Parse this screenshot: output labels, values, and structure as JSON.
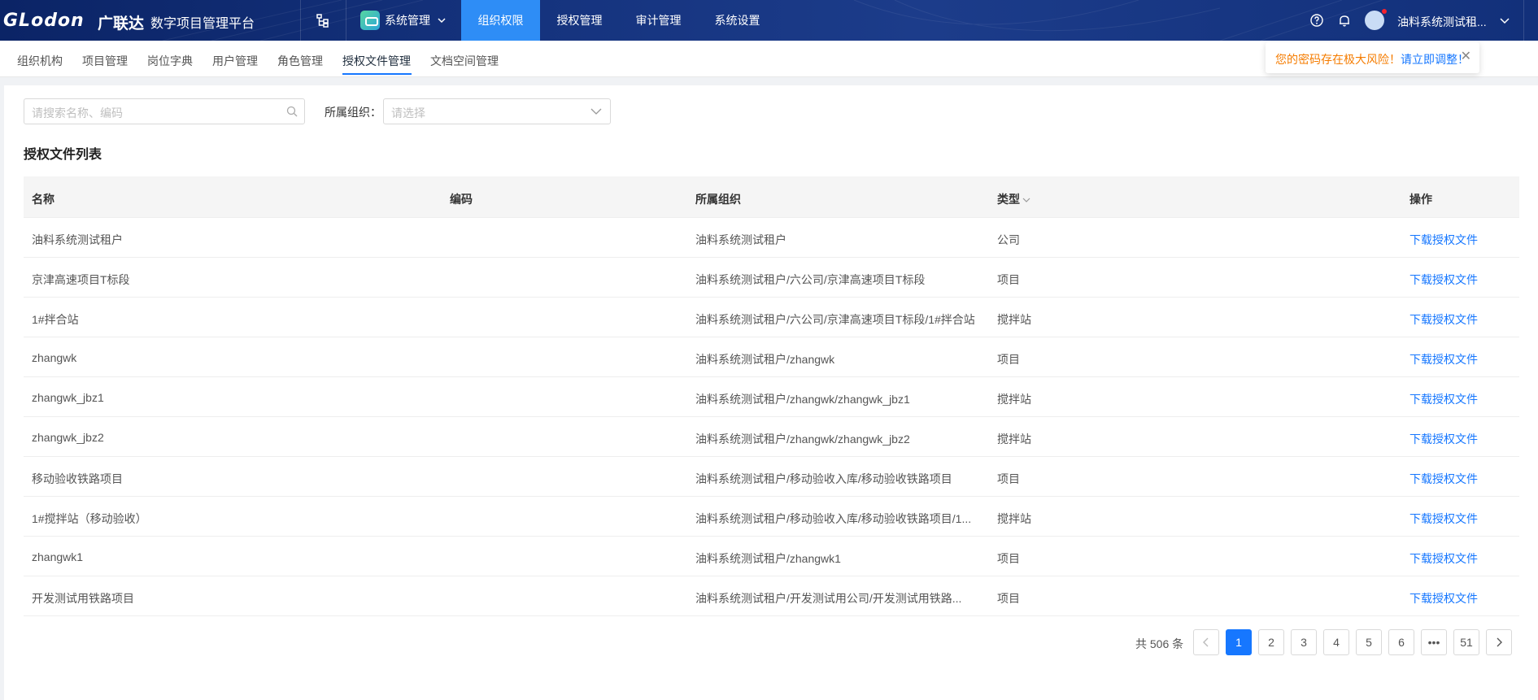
{
  "header": {
    "logo": "GLodon",
    "logo_cn": "广联达",
    "platform": "数字项目管理平台",
    "app_switcher": "系统管理",
    "nav": [
      "组织权限",
      "授权管理",
      "审计管理",
      "系统设置"
    ],
    "active_nav": "组织权限",
    "username": "油料系统测试租..."
  },
  "subnav": {
    "items": [
      "组织机构",
      "项目管理",
      "岗位字典",
      "用户管理",
      "角色管理",
      "授权文件管理",
      "文档空间管理"
    ],
    "active": "授权文件管理"
  },
  "warning": {
    "text": "您的密码存在极大风险！",
    "link": "请立即调整！"
  },
  "filters": {
    "search_placeholder": "请搜索名称、编码",
    "org_label": "所属组织：",
    "org_placeholder": "请选择"
  },
  "list_title": "授权文件列表",
  "table": {
    "columns": [
      "名称",
      "编码",
      "所属组织",
      "类型",
      "操作"
    ],
    "rows": [
      {
        "name": "油料系统测试租户",
        "code": "",
        "org": "油料系统测试租户",
        "type": "公司",
        "action": "下载授权文件"
      },
      {
        "name": "京津高速项目T标段",
        "code": "",
        "org": "油料系统测试租户/六公司/京津高速项目T标段",
        "type": "项目",
        "action": "下载授权文件"
      },
      {
        "name": "1#拌合站",
        "code": "",
        "org": "油料系统测试租户/六公司/京津高速项目T标段/1#拌合站",
        "type": "搅拌站",
        "action": "下载授权文件"
      },
      {
        "name": "zhangwk",
        "code": "",
        "org": "油料系统测试租户/zhangwk",
        "type": "项目",
        "action": "下载授权文件"
      },
      {
        "name": "zhangwk_jbz1",
        "code": "",
        "org": "油料系统测试租户/zhangwk/zhangwk_jbz1",
        "type": "搅拌站",
        "action": "下载授权文件"
      },
      {
        "name": "zhangwk_jbz2",
        "code": "",
        "org": "油料系统测试租户/zhangwk/zhangwk_jbz2",
        "type": "搅拌站",
        "action": "下载授权文件"
      },
      {
        "name": "移动验收铁路项目",
        "code": "",
        "org": "油料系统测试租户/移动验收入库/移动验收铁路项目",
        "type": "项目",
        "action": "下载授权文件"
      },
      {
        "name": "1#搅拌站（移动验收）",
        "code": "",
        "org": "油料系统测试租户/移动验收入库/移动验收铁路项目/1...",
        "type": "搅拌站",
        "action": "下载授权文件"
      },
      {
        "name": "zhangwk1",
        "code": "",
        "org": "油料系统测试租户/zhangwk1",
        "type": "项目",
        "action": "下载授权文件"
      },
      {
        "name": "开发测试用铁路项目",
        "code": "",
        "org": "油料系统测试租户/开发测试用公司/开发测试用铁路...",
        "type": "项目",
        "action": "下载授权文件"
      }
    ]
  },
  "pagination": {
    "total": "共 506 条",
    "pages": [
      "1",
      "2",
      "3",
      "4",
      "5",
      "6",
      "•••",
      "51"
    ],
    "current": "1"
  }
}
